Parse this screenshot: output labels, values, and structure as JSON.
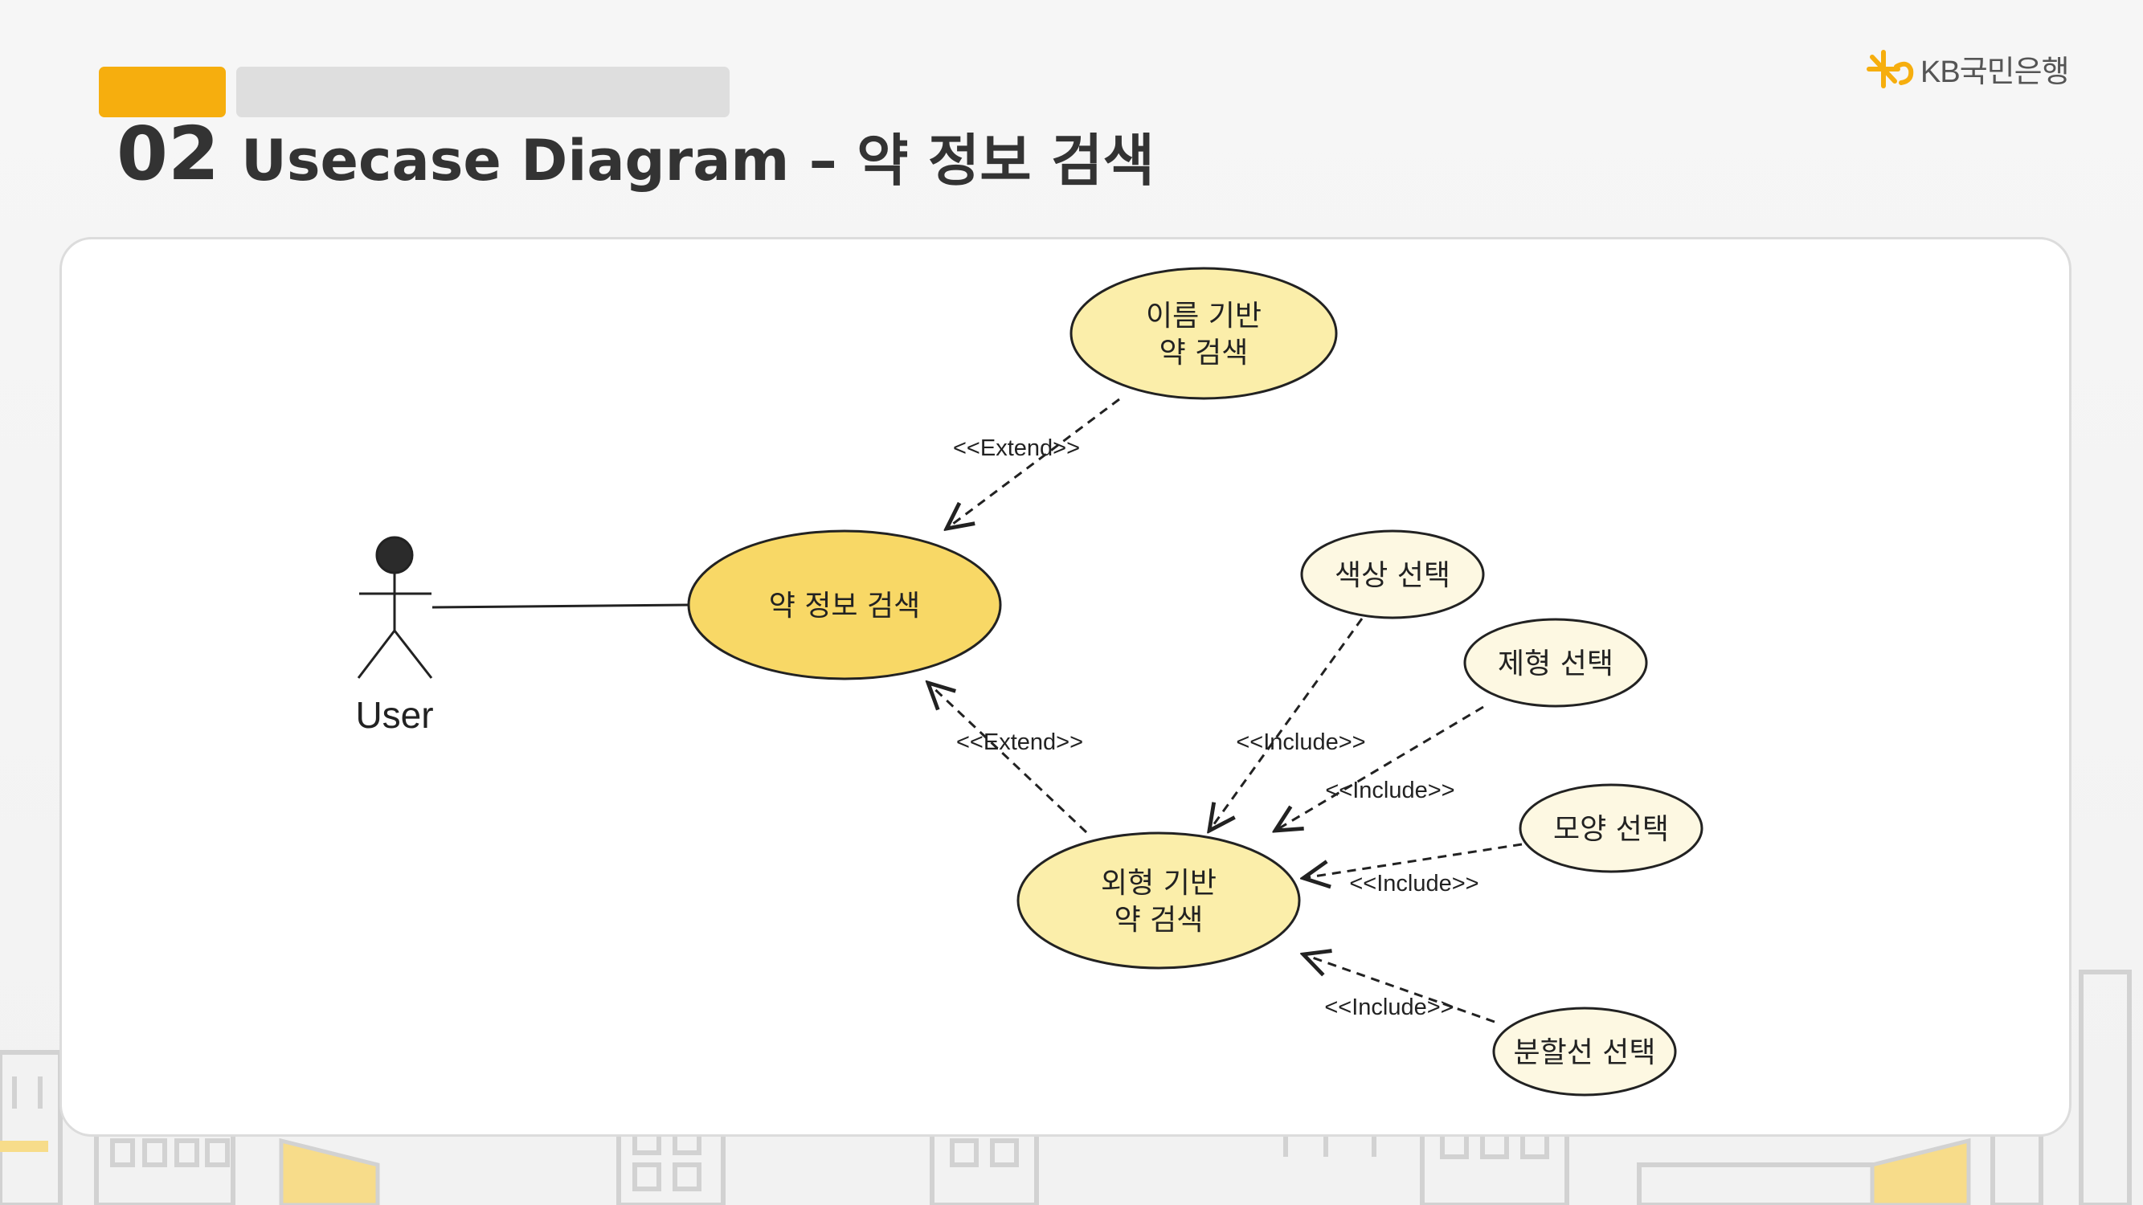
{
  "header": {
    "number": "02",
    "title": "Usecase Diagram – 약 정보 검색",
    "logo_text": "KB국민은행",
    "accent_color": "#f6ae0e"
  },
  "diagram": {
    "actor": {
      "label": "User"
    },
    "usecases": {
      "main": {
        "label": "약 정보 검색"
      },
      "name_search": {
        "line1": "이름 기반",
        "line2": "약 검색"
      },
      "shape_search": {
        "line1": "외형 기반",
        "line2": "약 검색"
      },
      "color": {
        "label": "색상 선택"
      },
      "form": {
        "label": "제형 선택"
      },
      "shape": {
        "label": "모양 선택"
      },
      "divider": {
        "label": "분할선 선택"
      }
    },
    "relations": {
      "extend_top": "<<Extend>>",
      "extend_bottom": "<<Extend>>",
      "include_color": "<<Include>>",
      "include_form": "<<Include>>",
      "include_shape": "<<Include>>",
      "include_divider": "<<Include>>"
    },
    "colors": {
      "main_fill": "#f8d866",
      "secondary_fill": "#fbeeaa",
      "light_fill": "#fdf8e2"
    }
  }
}
